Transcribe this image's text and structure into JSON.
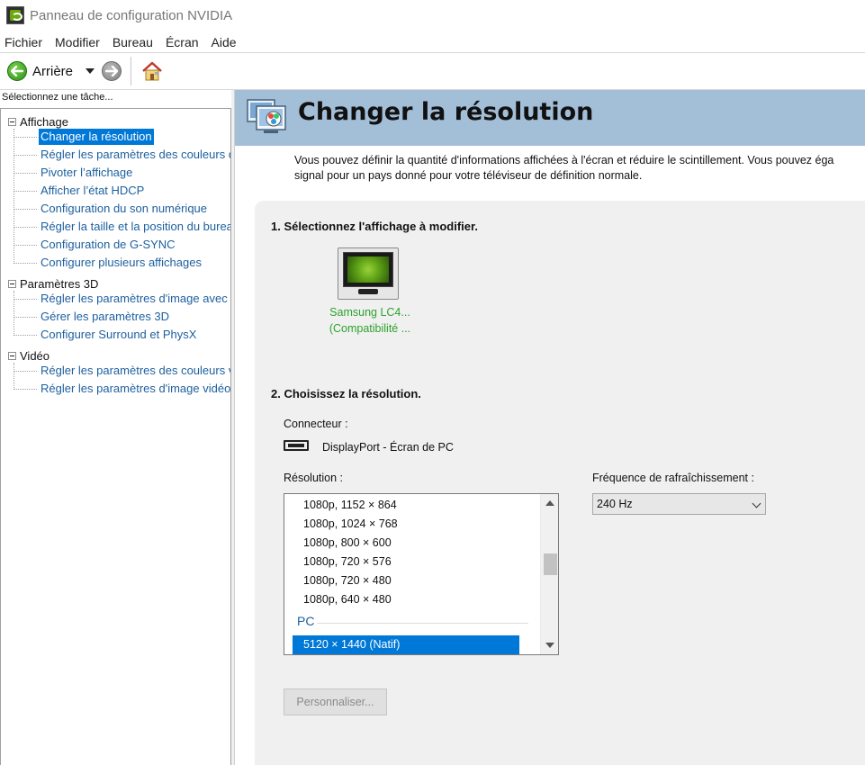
{
  "window": {
    "title": "Panneau de configuration NVIDIA"
  },
  "menu": {
    "items": [
      "Fichier",
      "Modifier",
      "Bureau",
      "Écran",
      "Aide"
    ]
  },
  "toolbar": {
    "back_label": "Arrière"
  },
  "sidebar": {
    "label": "Sélectionnez une tâche...",
    "groups": [
      {
        "label": "Affichage",
        "items": [
          "Changer la résolution",
          "Régler les paramètres des couleurs d",
          "Pivoter l’affichage",
          "Afficher l’état HDCP",
          "Configuration du son numérique",
          "Régler la taille et la position du burea",
          "Configuration de G-SYNC",
          "Configurer plusieurs affichages"
        ]
      },
      {
        "label": "Paramètres 3D",
        "items": [
          "Régler les paramètres d'image avec ..",
          "Gérer les paramètres 3D",
          "Configurer Surround et PhysX"
        ]
      },
      {
        "label": "Vidéo",
        "items": [
          "Régler les paramètres des couleurs v",
          "Régler les paramètres d'image vidéo"
        ]
      }
    ],
    "selected": "Changer la résolution"
  },
  "page": {
    "title": "Changer la résolution",
    "description_line1": "Vous pouvez définir la quantité d'informations affichées à l'écran et réduire le scintillement. Vous pouvez éga",
    "description_line2": "signal pour un pays donné pour votre téléviseur de définition normale."
  },
  "section1": {
    "title": "1. Sélectionnez l'affichage à modifier.",
    "display_name": "Samsung LC4...",
    "display_sub": "(Compatibilité ..."
  },
  "section2": {
    "title": "2. Choisissez la résolution.",
    "connector_label": "Connecteur :",
    "connector_value": "DisplayPort - Écran de PC",
    "resolution_label": "Résolution :",
    "refresh_label": "Fréquence de rafraîchissement :",
    "refresh_value": "240 Hz",
    "resolutions": [
      "1080p, 1152 × 864",
      "1080p, 1024 × 768",
      "1080p, 800 × 600",
      "1080p, 720 × 576",
      "1080p, 720 × 480",
      "1080p, 640 × 480"
    ],
    "group_pc": "PC",
    "selected_resolution": "5120 × 1440 (Natif)",
    "customize_button": "Personnaliser..."
  },
  "colors": {
    "accent": "#0078d7",
    "header": "#a3bed7",
    "link": "#1d5f9e",
    "display_label": "#2ea12e"
  }
}
